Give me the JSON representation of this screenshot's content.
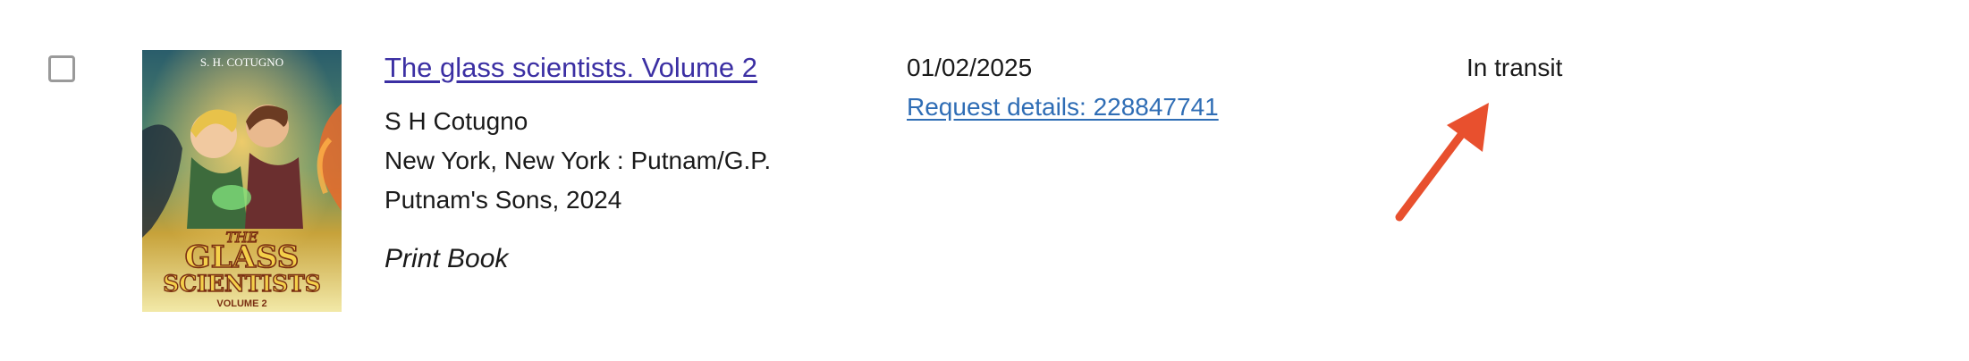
{
  "item": {
    "title": "The glass scientists. Volume 2",
    "author": "S H Cotugno",
    "publication_line1": "New York, New York : Putnam/G.P.",
    "publication_line2": "Putnam's Sons, 2024",
    "format": "Print Book",
    "date": "01/02/2025",
    "request_details": "Request details: 228847741",
    "status": "In transit",
    "checked": false
  },
  "cover": {
    "author_text": "S. H. COTUGNO",
    "title_line1": "THE",
    "title_line2": "GLASS",
    "title_line3": "SCIENTISTS",
    "volume_text": "VOLUME 2"
  },
  "annotation": {
    "arrow_color": "#e8502e"
  },
  "colors": {
    "title_link": "#3b2fa3",
    "request_link": "#2f6db5"
  }
}
